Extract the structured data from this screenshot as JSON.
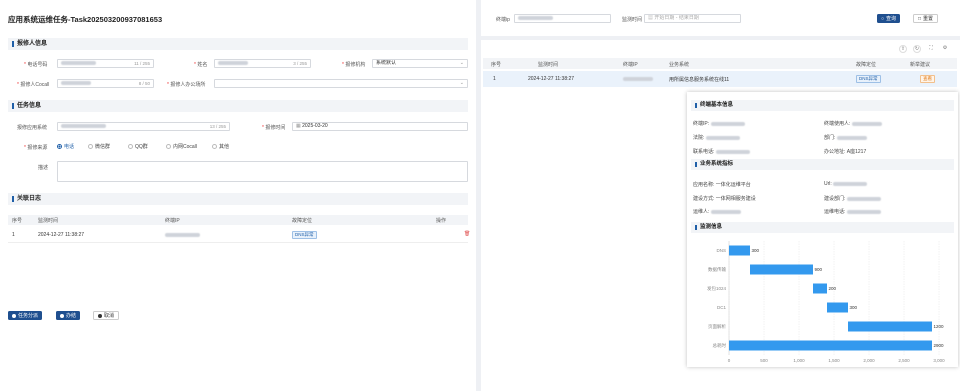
{
  "left": {
    "title": "应用系统运维任务-Task202503200937081653",
    "reporter_section": "报修人信息",
    "fields": {
      "phone_label": "电话号码",
      "phone_count": "11 / 255",
      "name_label": "姓名",
      "name_count": "3 / 255",
      "org_label": "报修机构",
      "org_value": "系统默认",
      "cocall_label": "报修人Cocall",
      "cocall_count": "8 / 50",
      "office_label": "报修人办公场所"
    },
    "task_section": "任务信息",
    "task": {
      "app_label": "报修应用系统",
      "app_count": "13 / 255",
      "time_label": "报修时间",
      "time_value": "2025-03-20",
      "source_label": "报修来源",
      "sources": [
        "电话",
        "微信群",
        "QQ群",
        "内网Cocall",
        "其他"
      ],
      "desc_label": "描述"
    },
    "log_section": "关联日志",
    "log_table": {
      "headers": [
        "序号",
        "监测时间",
        "终端IP",
        "故障定位",
        "操作"
      ],
      "rows": [
        {
          "no": "1",
          "time": "2024-12-27 11:38:27",
          "tag": "DNS异常"
        }
      ]
    },
    "buttons": {
      "split": "任务分派",
      "handle": "办结",
      "cancel": "取消"
    }
  },
  "right": {
    "filters": {
      "ip_label": "终端ip",
      "time_label": "监测时间",
      "start_placeholder": "开始日期",
      "sep": "-",
      "end_placeholder": "结束日期",
      "query": "查询",
      "reset": "重置"
    },
    "table": {
      "headers": [
        "序号",
        "监测时间",
        "终端IP",
        "业务系统",
        "故障定位",
        "新举建议"
      ],
      "rows": [
        {
          "no": "1",
          "time": "2024-12-27 11:38:27",
          "system": "用所属信息服务系统在线11",
          "tag": "DNS异常",
          "advice": "查看"
        }
      ]
    },
    "popup": {
      "terminal_section": "终端基本信息",
      "terminal": {
        "ip_label": "终端IP:",
        "user_label": "终端使用人:",
        "office_label": "法院:",
        "dept_label": "部门:",
        "phone_label": "联系电话:",
        "addr_label": "办公地址:",
        "addr_value": "A座1217"
      },
      "biz_section": "业务系统指标",
      "biz": {
        "app_label": "应用名称:",
        "app_value": "一体化运维平台",
        "url_label": "Url:",
        "build_label": "建设方式:",
        "build_value": "一体网相服务建设",
        "dept_label": "建设部门:",
        "ops_label": "运维人:",
        "ops_phone_label": "运维电话:"
      },
      "mon_section": "监测信息"
    }
  },
  "chart_data": {
    "type": "bar",
    "orientation": "horizontal-waterfall",
    "categories": [
      "DNS",
      "数据传输",
      "发包1024",
      "DC1",
      "页面解析",
      "总耗时"
    ],
    "series": [
      {
        "values": [
          300,
          900,
          200,
          300,
          1200,
          2900
        ],
        "starts": [
          0,
          300,
          1200,
          1400,
          1700,
          0
        ]
      }
    ],
    "value_labels": [
      "300",
      "900",
      "200",
      "300",
      "1200",
      "2900"
    ],
    "xticks": [
      "0",
      "500",
      "1,000",
      "1,500",
      "2,000",
      "2,500",
      "3,000"
    ],
    "xlim": [
      0,
      3000
    ],
    "bar_color": "#3399ee"
  }
}
